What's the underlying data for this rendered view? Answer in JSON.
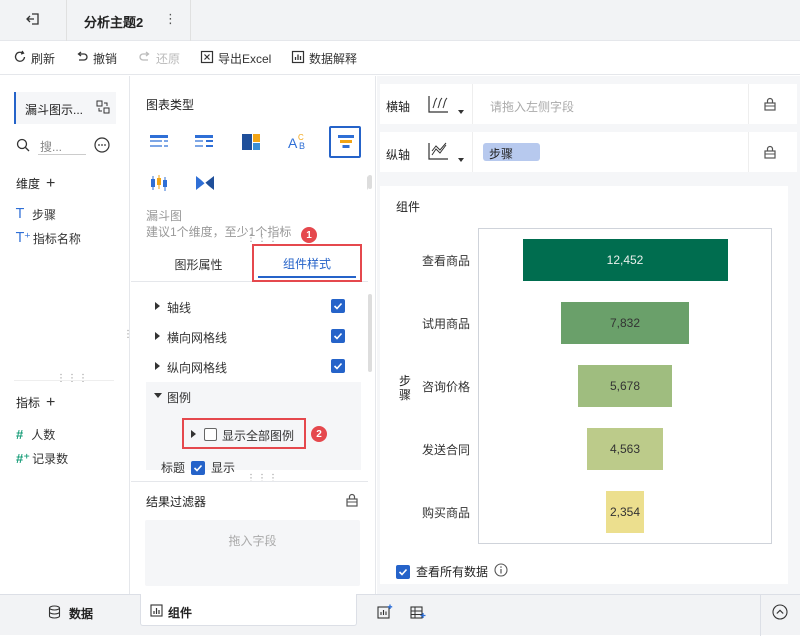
{
  "topbar": {
    "title": "分析主题2"
  },
  "toolbar": {
    "refresh": "刷新",
    "undo": "撤销",
    "redo": "还原",
    "export": "导出Excel",
    "explain": "数据解释"
  },
  "left": {
    "component_name": "漏斗图示...",
    "search_placeholder": "搜...",
    "dimension_title": "维度",
    "dimensions": [
      "步骤",
      "指标名称"
    ],
    "measure_title": "指标",
    "measures": [
      "人数",
      "记录数"
    ]
  },
  "mid": {
    "chart_type_title": "图表类型",
    "chart_name": "漏斗图",
    "chart_hint": "建议1个维度，至少1个指标",
    "tab_shape": "图形属性",
    "tab_style": "组件样式",
    "props": [
      "轴线",
      "横向网格线",
      "纵向网格线"
    ],
    "legend_title": "图例",
    "show_all_legend": "显示全部图例",
    "title_label": "标题",
    "title_show": "显示",
    "filter_title": "结果过滤器",
    "filter_placeholder": "拖入字段",
    "badge1": "1",
    "badge2": "2"
  },
  "right": {
    "x_axis_label": "横轴",
    "x_axis_placeholder": "请拖入左侧字段",
    "y_axis_label": "纵轴",
    "y_axis_field": "步骤",
    "panel_title": "组件",
    "y_axis_title": "步骤",
    "view_all": "查看所有数据"
  },
  "chart_data": {
    "type": "funnel",
    "categories": [
      "查看商品",
      "试用商品",
      "咨询价格",
      "发送合同",
      "购买商品"
    ],
    "values": [
      12452,
      7832,
      5678,
      4563,
      2354
    ],
    "labels": [
      "12,452",
      "7,832",
      "5,678",
      "4,563",
      "2,354"
    ],
    "colors": [
      "#006d4f",
      "#6aa06a",
      "#9fbd7f",
      "#bccb8a",
      "#ecdf8e"
    ],
    "ylabel": "步骤"
  },
  "bottom": {
    "tab_label": "组件"
  }
}
